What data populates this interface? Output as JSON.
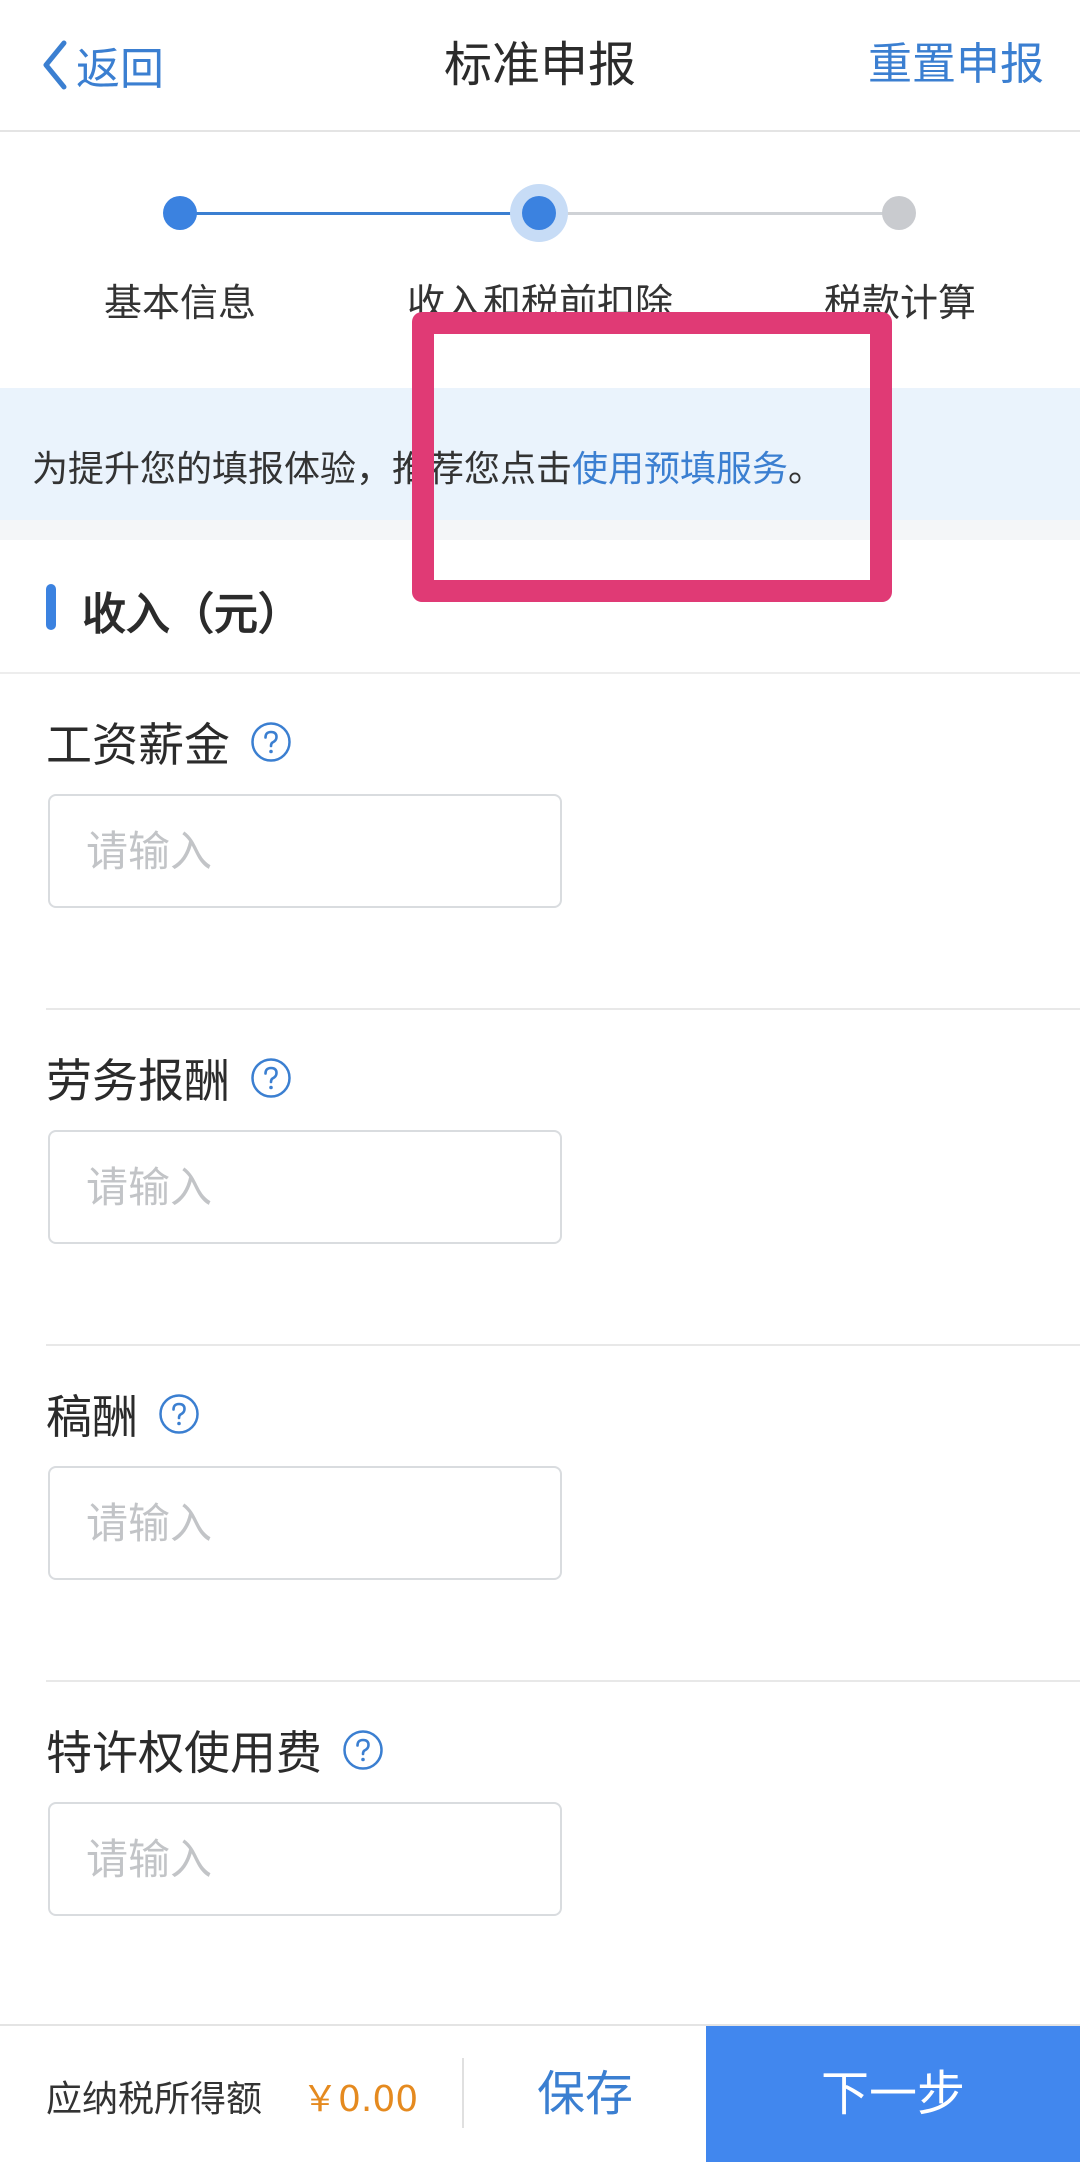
{
  "header": {
    "back_label": "返回",
    "title": "标准申报",
    "reset_label": "重置申报"
  },
  "stepper": {
    "steps": [
      {
        "label": "基本信息",
        "state": "completed"
      },
      {
        "label": "收入和税前扣除",
        "state": "active"
      },
      {
        "label": "税款计算",
        "state": "pending"
      }
    ]
  },
  "notice": {
    "prefix": "为提升您的填报体验，推荐您点击",
    "link": "使用预填服务",
    "suffix": "。"
  },
  "section": {
    "title": "收入（元）"
  },
  "fields": [
    {
      "label": "工资薪金",
      "placeholder": "请输入",
      "value": ""
    },
    {
      "label": "劳务报酬",
      "placeholder": "请输入",
      "value": ""
    },
    {
      "label": "稿酬",
      "placeholder": "请输入",
      "value": ""
    },
    {
      "label": "特许权使用费",
      "placeholder": "请输入",
      "value": ""
    }
  ],
  "bottom_bar": {
    "tax_label": "应纳税所得额",
    "tax_value": "￥0.00",
    "save_label": "保存",
    "next_label": "下一步"
  },
  "colors": {
    "accent": "#3b7fd1",
    "primary_button": "#4187ee",
    "highlight": "#e03a75",
    "amount": "#e58a1f",
    "notice_bg": "#eaf3fc"
  },
  "icons": {
    "back": "chevron-left-icon",
    "help": "question-circle-icon"
  }
}
